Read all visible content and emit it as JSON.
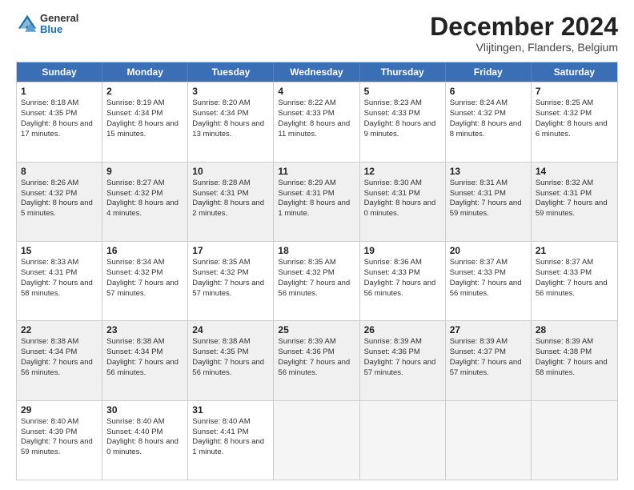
{
  "header": {
    "logo_general": "General",
    "logo_blue": "Blue",
    "month_title": "December 2024",
    "location": "Vlijtingen, Flanders, Belgium"
  },
  "days_of_week": [
    "Sunday",
    "Monday",
    "Tuesday",
    "Wednesday",
    "Thursday",
    "Friday",
    "Saturday"
  ],
  "weeks": [
    [
      {
        "day": "1",
        "sunrise": "8:18 AM",
        "sunset": "4:35 PM",
        "daylight": "8 hours and 17 minutes.",
        "shaded": false
      },
      {
        "day": "2",
        "sunrise": "8:19 AM",
        "sunset": "4:34 PM",
        "daylight": "8 hours and 15 minutes.",
        "shaded": false
      },
      {
        "day": "3",
        "sunrise": "8:20 AM",
        "sunset": "4:34 PM",
        "daylight": "8 hours and 13 minutes.",
        "shaded": false
      },
      {
        "day": "4",
        "sunrise": "8:22 AM",
        "sunset": "4:33 PM",
        "daylight": "8 hours and 11 minutes.",
        "shaded": false
      },
      {
        "day": "5",
        "sunrise": "8:23 AM",
        "sunset": "4:33 PM",
        "daylight": "8 hours and 9 minutes.",
        "shaded": false
      },
      {
        "day": "6",
        "sunrise": "8:24 AM",
        "sunset": "4:32 PM",
        "daylight": "8 hours and 8 minutes.",
        "shaded": false
      },
      {
        "day": "7",
        "sunrise": "8:25 AM",
        "sunset": "4:32 PM",
        "daylight": "8 hours and 6 minutes.",
        "shaded": false
      }
    ],
    [
      {
        "day": "8",
        "sunrise": "8:26 AM",
        "sunset": "4:32 PM",
        "daylight": "8 hours and 5 minutes.",
        "shaded": true
      },
      {
        "day": "9",
        "sunrise": "8:27 AM",
        "sunset": "4:32 PM",
        "daylight": "8 hours and 4 minutes.",
        "shaded": true
      },
      {
        "day": "10",
        "sunrise": "8:28 AM",
        "sunset": "4:31 PM",
        "daylight": "8 hours and 2 minutes.",
        "shaded": true
      },
      {
        "day": "11",
        "sunrise": "8:29 AM",
        "sunset": "4:31 PM",
        "daylight": "8 hours and 1 minute.",
        "shaded": true
      },
      {
        "day": "12",
        "sunrise": "8:30 AM",
        "sunset": "4:31 PM",
        "daylight": "8 hours and 0 minutes.",
        "shaded": true
      },
      {
        "day": "13",
        "sunrise": "8:31 AM",
        "sunset": "4:31 PM",
        "daylight": "7 hours and 59 minutes.",
        "shaded": true
      },
      {
        "day": "14",
        "sunrise": "8:32 AM",
        "sunset": "4:31 PM",
        "daylight": "7 hours and 59 minutes.",
        "shaded": true
      }
    ],
    [
      {
        "day": "15",
        "sunrise": "8:33 AM",
        "sunset": "4:31 PM",
        "daylight": "7 hours and 58 minutes.",
        "shaded": false
      },
      {
        "day": "16",
        "sunrise": "8:34 AM",
        "sunset": "4:32 PM",
        "daylight": "7 hours and 57 minutes.",
        "shaded": false
      },
      {
        "day": "17",
        "sunrise": "8:35 AM",
        "sunset": "4:32 PM",
        "daylight": "7 hours and 57 minutes.",
        "shaded": false
      },
      {
        "day": "18",
        "sunrise": "8:35 AM",
        "sunset": "4:32 PM",
        "daylight": "7 hours and 56 minutes.",
        "shaded": false
      },
      {
        "day": "19",
        "sunrise": "8:36 AM",
        "sunset": "4:33 PM",
        "daylight": "7 hours and 56 minutes.",
        "shaded": false
      },
      {
        "day": "20",
        "sunrise": "8:37 AM",
        "sunset": "4:33 PM",
        "daylight": "7 hours and 56 minutes.",
        "shaded": false
      },
      {
        "day": "21",
        "sunrise": "8:37 AM",
        "sunset": "4:33 PM",
        "daylight": "7 hours and 56 minutes.",
        "shaded": false
      }
    ],
    [
      {
        "day": "22",
        "sunrise": "8:38 AM",
        "sunset": "4:34 PM",
        "daylight": "7 hours and 56 minutes.",
        "shaded": true
      },
      {
        "day": "23",
        "sunrise": "8:38 AM",
        "sunset": "4:34 PM",
        "daylight": "7 hours and 56 minutes.",
        "shaded": true
      },
      {
        "day": "24",
        "sunrise": "8:38 AM",
        "sunset": "4:35 PM",
        "daylight": "7 hours and 56 minutes.",
        "shaded": true
      },
      {
        "day": "25",
        "sunrise": "8:39 AM",
        "sunset": "4:36 PM",
        "daylight": "7 hours and 56 minutes.",
        "shaded": true
      },
      {
        "day": "26",
        "sunrise": "8:39 AM",
        "sunset": "4:36 PM",
        "daylight": "7 hours and 57 minutes.",
        "shaded": true
      },
      {
        "day": "27",
        "sunrise": "8:39 AM",
        "sunset": "4:37 PM",
        "daylight": "7 hours and 57 minutes.",
        "shaded": true
      },
      {
        "day": "28",
        "sunrise": "8:39 AM",
        "sunset": "4:38 PM",
        "daylight": "7 hours and 58 minutes.",
        "shaded": true
      }
    ],
    [
      {
        "day": "29",
        "sunrise": "8:40 AM",
        "sunset": "4:39 PM",
        "daylight": "7 hours and 59 minutes.",
        "shaded": false
      },
      {
        "day": "30",
        "sunrise": "8:40 AM",
        "sunset": "4:40 PM",
        "daylight": "8 hours and 0 minutes.",
        "shaded": false
      },
      {
        "day": "31",
        "sunrise": "8:40 AM",
        "sunset": "4:41 PM",
        "daylight": "8 hours and 1 minute.",
        "shaded": false
      },
      {
        "day": "",
        "sunrise": "",
        "sunset": "",
        "daylight": "",
        "shaded": false,
        "empty": true
      },
      {
        "day": "",
        "sunrise": "",
        "sunset": "",
        "daylight": "",
        "shaded": false,
        "empty": true
      },
      {
        "day": "",
        "sunrise": "",
        "sunset": "",
        "daylight": "",
        "shaded": false,
        "empty": true
      },
      {
        "day": "",
        "sunrise": "",
        "sunset": "",
        "daylight": "",
        "shaded": false,
        "empty": true
      }
    ]
  ]
}
